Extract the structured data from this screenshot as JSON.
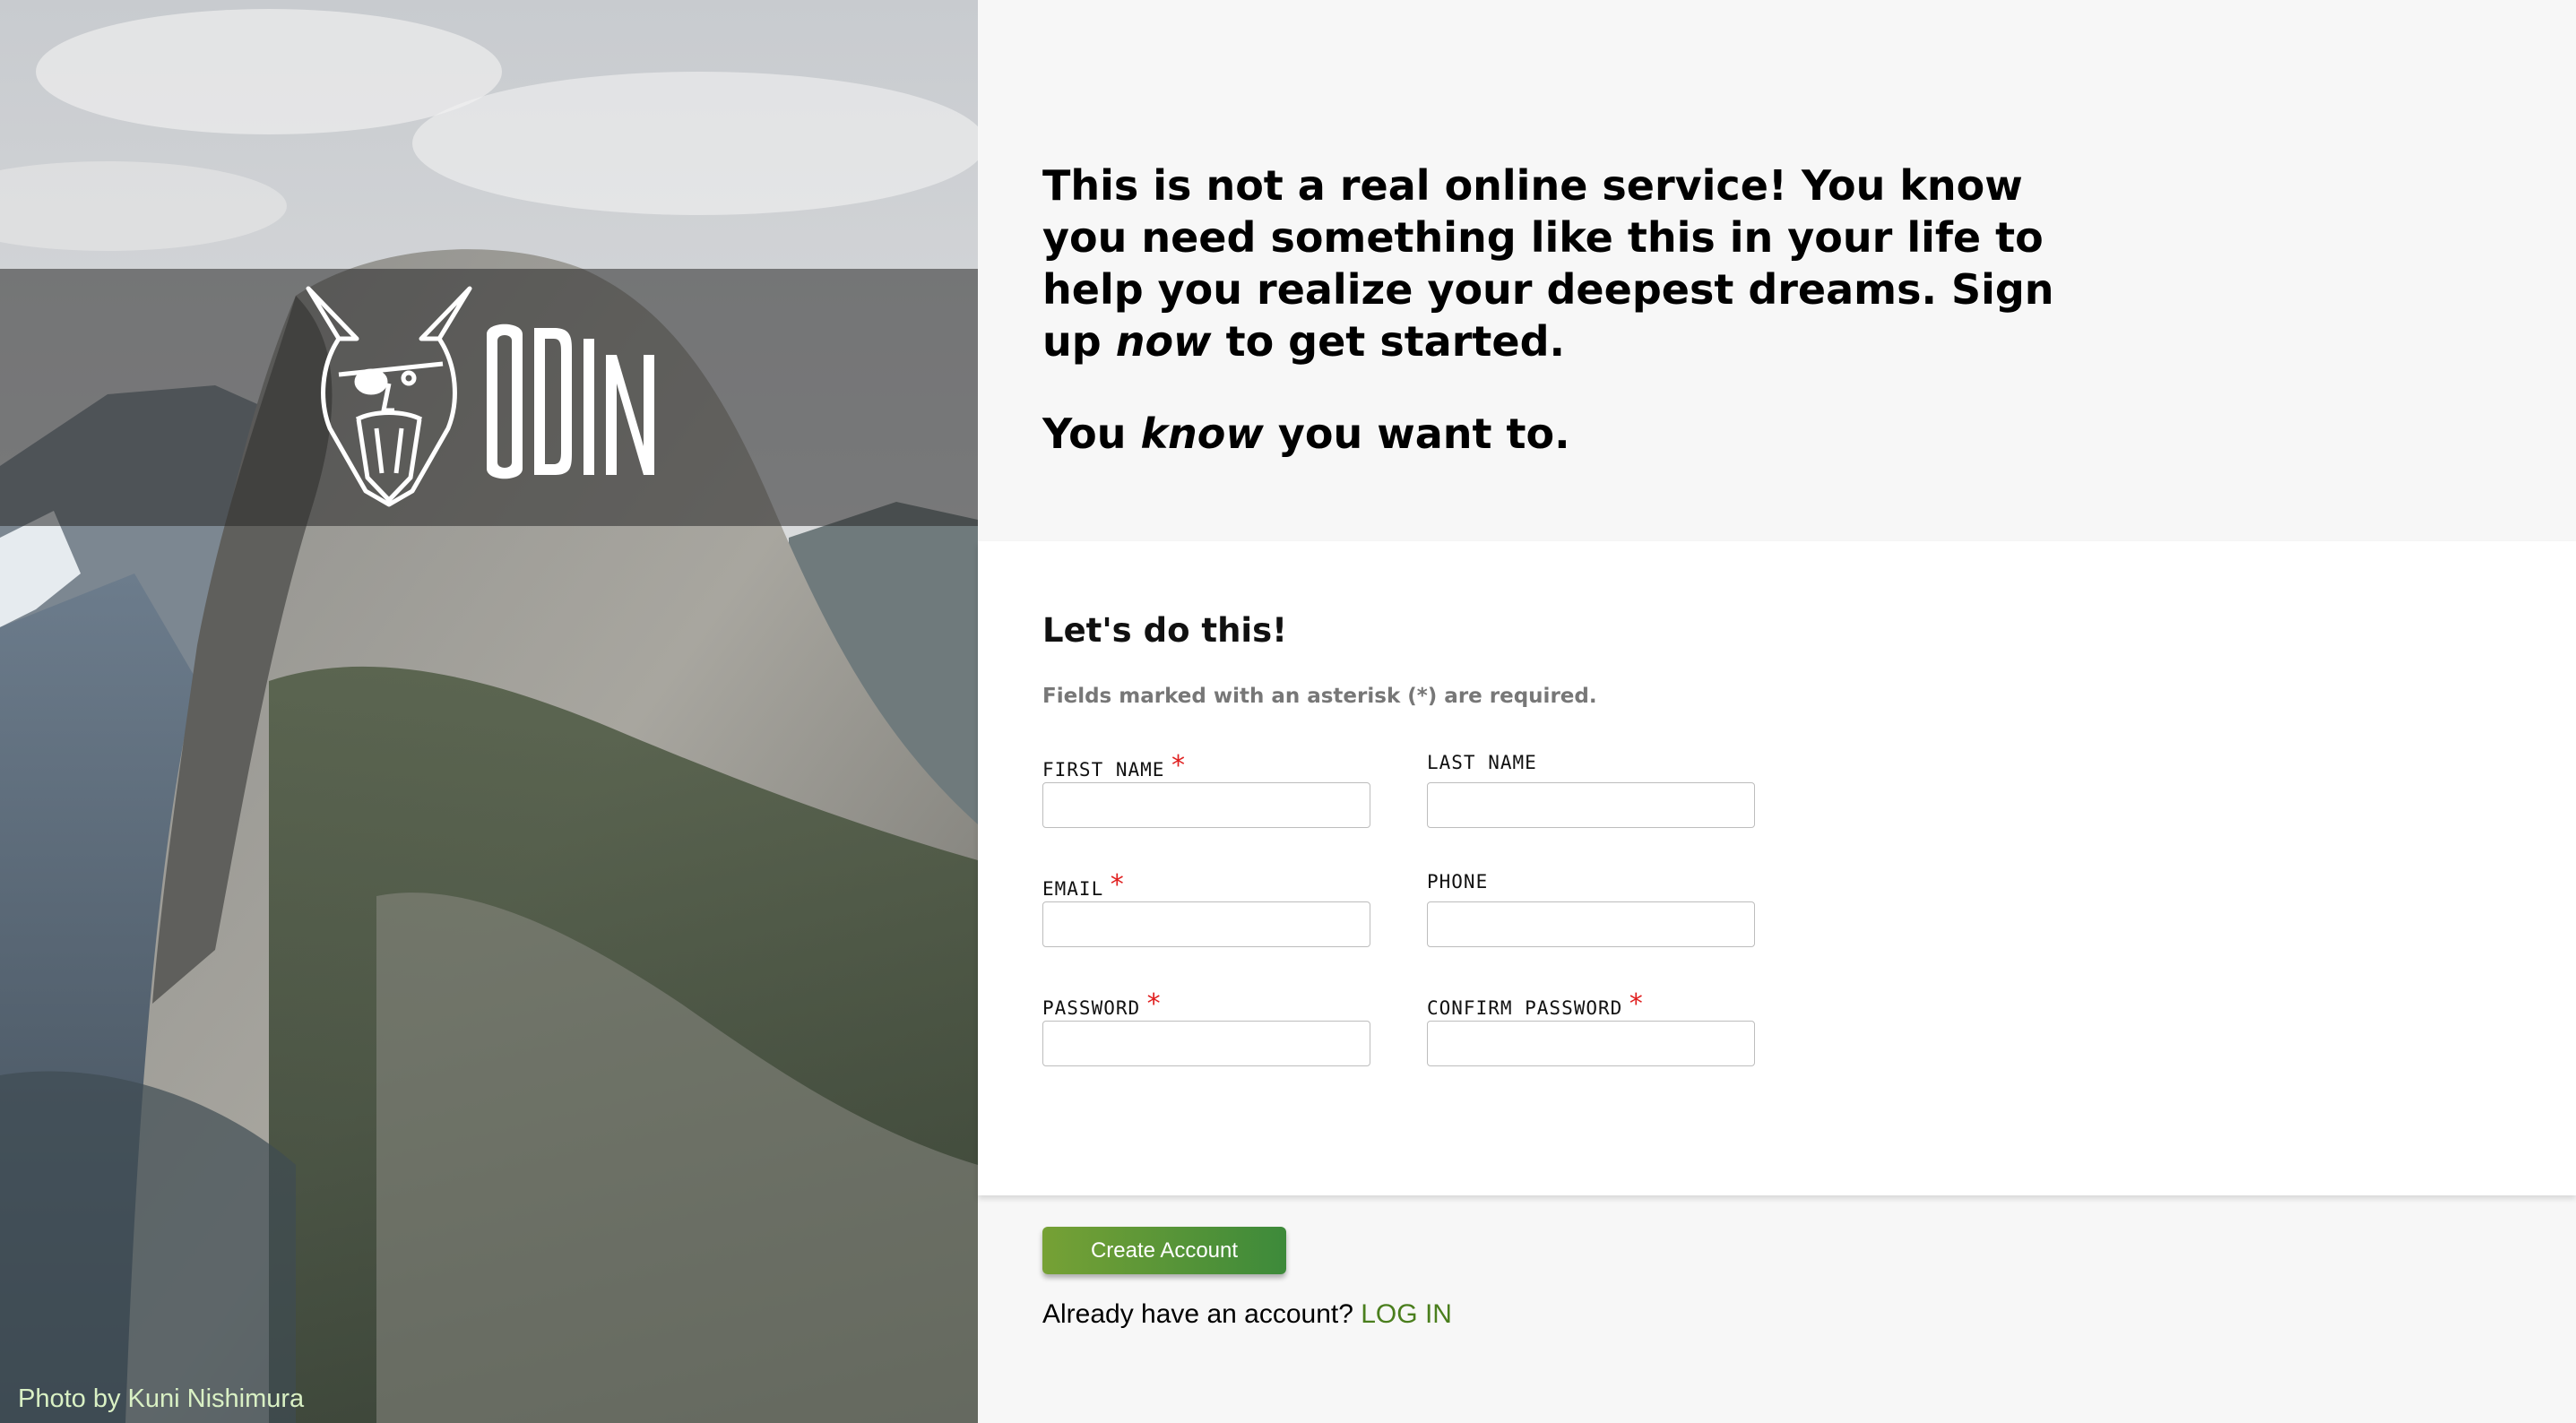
{
  "hero": {
    "logo_text": "ODIN",
    "photo_credit": "Photo by Kuni Nishimura"
  },
  "intro": {
    "paragraph1_part1": "This is not a real online service! You know you need something like this in your life to help you realize your deepest dreams. Sign up ",
    "paragraph1_emphasis": "now",
    "paragraph1_part2": " to get started.",
    "paragraph2_part1": "You ",
    "paragraph2_emphasis": "know",
    "paragraph2_part2": " you want to."
  },
  "form": {
    "title": "Let's do this!",
    "note": "Fields marked with an asterisk (*) are required.",
    "required_marker": "*",
    "fields": {
      "first_name": {
        "label": "FIRST NAME",
        "value": ""
      },
      "last_name": {
        "label": "LAST NAME",
        "value": ""
      },
      "email": {
        "label": "EMAIL",
        "value": ""
      },
      "phone": {
        "label": "PHONE",
        "value": ""
      },
      "password": {
        "label": "PASSWORD",
        "value": ""
      },
      "confirm_password": {
        "label": "CONFIRM PASSWORD",
        "value": ""
      }
    }
  },
  "actions": {
    "create_label": "Create Account",
    "login_prompt": "Already have an account? ",
    "login_link": "LOG IN"
  },
  "colors": {
    "button_start": "#76a135",
    "button_end": "#3d8a3a",
    "link": "#4a7e1d",
    "required": "#e02020"
  }
}
